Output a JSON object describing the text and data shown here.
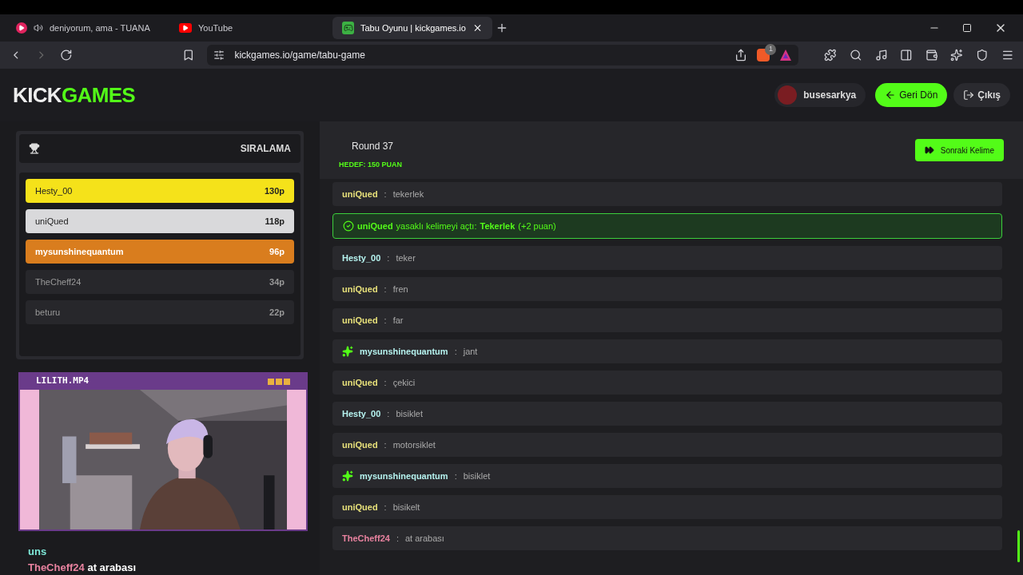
{
  "browser": {
    "tabs": [
      {
        "title": "deniyorum, ama - TUANA",
        "selected": false,
        "kind": "music"
      },
      {
        "title": "YouTube",
        "selected": false,
        "kind": "video"
      },
      {
        "title": "Tabu Oyunu | kickgames.io",
        "selected": true,
        "kind": "game"
      }
    ],
    "url": "kickgames.io/game/tabu-game",
    "shields_badge": "1"
  },
  "header": {
    "logo_left": "KICK",
    "logo_right": "GAMES",
    "user": "busesarkya",
    "back_button": "Geri Dön",
    "logout_button": "Çıkış"
  },
  "leaderboard": {
    "title": "SIRALAMA",
    "players": [
      {
        "name": "Hesty_00",
        "score": "130p",
        "color": "#f5e21a"
      },
      {
        "name": "uniQued",
        "score": "118p",
        "color": "#d9d9db"
      },
      {
        "name": "mysunshinequantum",
        "score": "96p",
        "color": "#d97d1e"
      },
      {
        "name": "TheCheff24",
        "score": "34p",
        "color": "#27272b"
      },
      {
        "name": "beturu",
        "score": "22p",
        "color": "#27272b"
      }
    ]
  },
  "webcam": {
    "title": "LILITH.MP4"
  },
  "stream_captions": [
    {
      "user": "uns",
      "color": "#7ee8d8"
    },
    {
      "user": "TheCheff24",
      "text": "at arabası",
      "color": "#e8829f"
    }
  ],
  "round": {
    "title": "Round 37",
    "target": "HEDEF: 150 PUAN",
    "next_button": "Sonraki Kelime"
  },
  "chat": [
    {
      "kind": "message",
      "user": "uniQued",
      "separator": ":",
      "text": "tekerlek",
      "color": "#e7e07a",
      "starred": false
    },
    {
      "kind": "event",
      "user": "uniQued",
      "text": "yasaklı kelimeyi açtı:",
      "word": "Tekerlek",
      "bonus": "(+2 puan)"
    },
    {
      "kind": "message",
      "user": "Hesty_00",
      "separator": ":",
      "text": "teker",
      "color": "#b5f2ee",
      "starred": false
    },
    {
      "kind": "message",
      "user": "uniQued",
      "separator": ":",
      "text": "fren",
      "color": "#e7e07a",
      "starred": false
    },
    {
      "kind": "message",
      "user": "uniQued",
      "separator": ":",
      "text": "far",
      "color": "#e7e07a",
      "starred": false
    },
    {
      "kind": "message",
      "user": "mysunshinequantum",
      "separator": ":",
      "text": "jant",
      "color": "#b5f2ee",
      "starred": true
    },
    {
      "kind": "message",
      "user": "uniQued",
      "separator": ":",
      "text": "çekici",
      "color": "#e7e07a",
      "starred": false
    },
    {
      "kind": "message",
      "user": "Hesty_00",
      "separator": ":",
      "text": "bisiklet",
      "color": "#b5f2ee",
      "starred": false
    },
    {
      "kind": "message",
      "user": "uniQued",
      "separator": ":",
      "text": "motorsiklet",
      "color": "#e7e07a",
      "starred": false
    },
    {
      "kind": "message",
      "user": "mysunshinequantum",
      "separator": ":",
      "text": "bisiklet",
      "color": "#b5f2ee",
      "starred": true
    },
    {
      "kind": "message",
      "user": "uniQued",
      "separator": ":",
      "text": "bisikelt",
      "color": "#e7e07a",
      "starred": false
    },
    {
      "kind": "message",
      "user": "TheCheff24",
      "separator": ":",
      "text": "at arabası",
      "color": "#e8829f",
      "starred": false
    }
  ]
}
